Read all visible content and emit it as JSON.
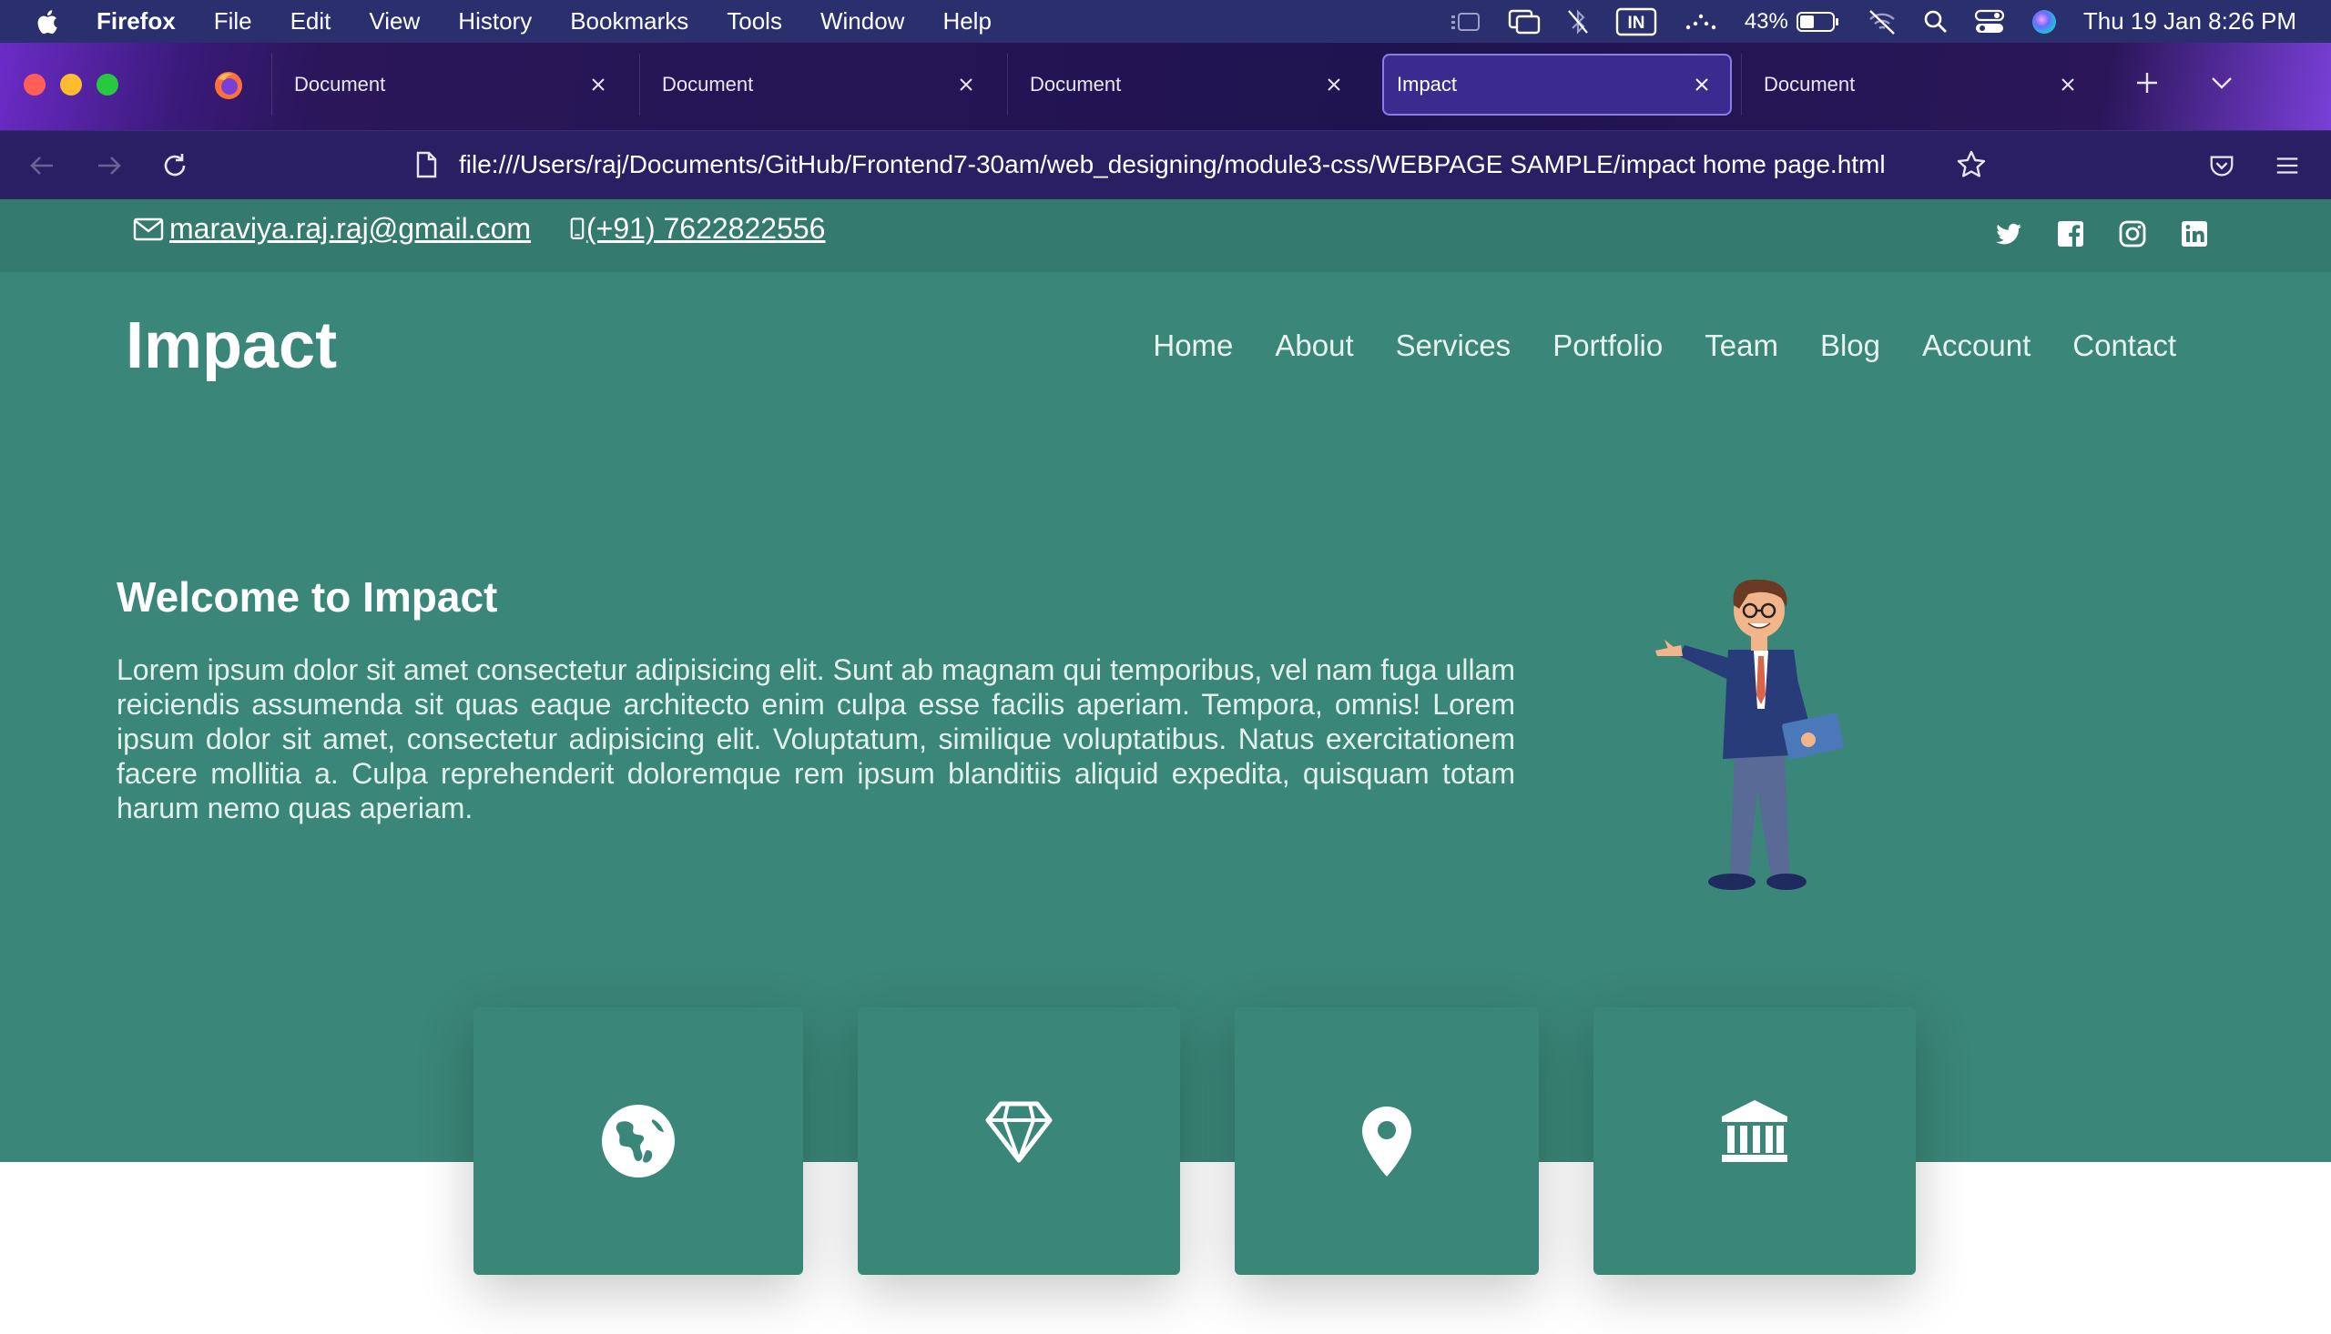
{
  "menubar": {
    "app_name": "Firefox",
    "items": [
      "File",
      "Edit",
      "View",
      "History",
      "Bookmarks",
      "Tools",
      "Window",
      "Help"
    ],
    "input_source": "IN",
    "battery": "43%",
    "clock": "Thu 19 Jan  8:26 PM"
  },
  "browser": {
    "tabs": [
      {
        "title": "Document",
        "active": false
      },
      {
        "title": "Document",
        "active": false
      },
      {
        "title": "Document",
        "active": false
      },
      {
        "title": "Impact",
        "active": true
      },
      {
        "title": "Document",
        "active": false
      }
    ],
    "url": "file:///Users/raj/Documents/GitHub/Frontend7-30am/web_designing/module3-css/WEBPAGE SAMPLE/impact home page.html"
  },
  "page": {
    "topbar": {
      "email": "maraviya.raj.raj@gmail.com",
      "phone": "(+91) 7622822556",
      "social_icons": [
        "twitter-icon",
        "facebook-icon",
        "instagram-icon",
        "linkedin-icon"
      ]
    },
    "logo": "Impact",
    "nav": [
      "Home",
      "About",
      "Services",
      "Portfolio",
      "Team",
      "Blog",
      "Account",
      "Contact"
    ],
    "hero": {
      "title": "Welcome to Impact",
      "text": "Lorem ipsum dolor sit amet consectetur adipisicing elit. Sunt ab magnam qui temporibus, vel nam fuga ullam reiciendis assumenda sit quas eaque architecto enim culpa esse facilis aperiam. Tempora, omnis! Lorem ipsum dolor sit amet, consectetur adipisicing elit. Voluptatum, similique voluptatibus. Natus exercitationem facere mollitia a. Culpa reprehenderit doloremque rem ipsum blanditiis aliquid expedita, quisquam totam harum nemo quas aperiam."
    },
    "cards": [
      "globe-icon",
      "diamond-icon",
      "map-pin-icon",
      "bank-icon"
    ],
    "colors": {
      "topbar": "#357a6e",
      "header": "#3a8678",
      "menubar": "#2a2f6e",
      "toolbar": "#2b1f63"
    }
  }
}
